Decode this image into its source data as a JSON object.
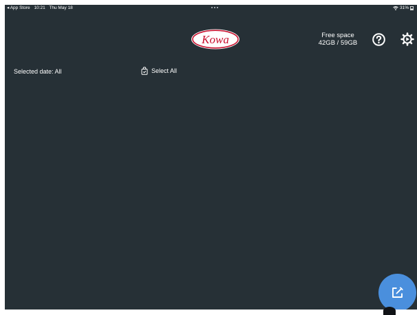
{
  "status_bar": {
    "back_app": "◂ App Store",
    "time": "10:21",
    "date": "Thu May 18",
    "battery": "31%"
  },
  "header": {
    "logo_text": "Kowa",
    "free_space_label": "Free space",
    "free_space_value": "42GB / 59GB",
    "help_icon": "question-circle-icon",
    "settings_icon": "gear-icon"
  },
  "toolbar": {
    "selected_date_label": "Selected date: All",
    "select_all_label": "Select All",
    "select_all_icon": "bag-check-icon"
  },
  "fab": {
    "icon": "edit-icon",
    "color": "#4a8fdd"
  },
  "colors": {
    "background": "#263036",
    "logo_red": "#c8102e"
  }
}
